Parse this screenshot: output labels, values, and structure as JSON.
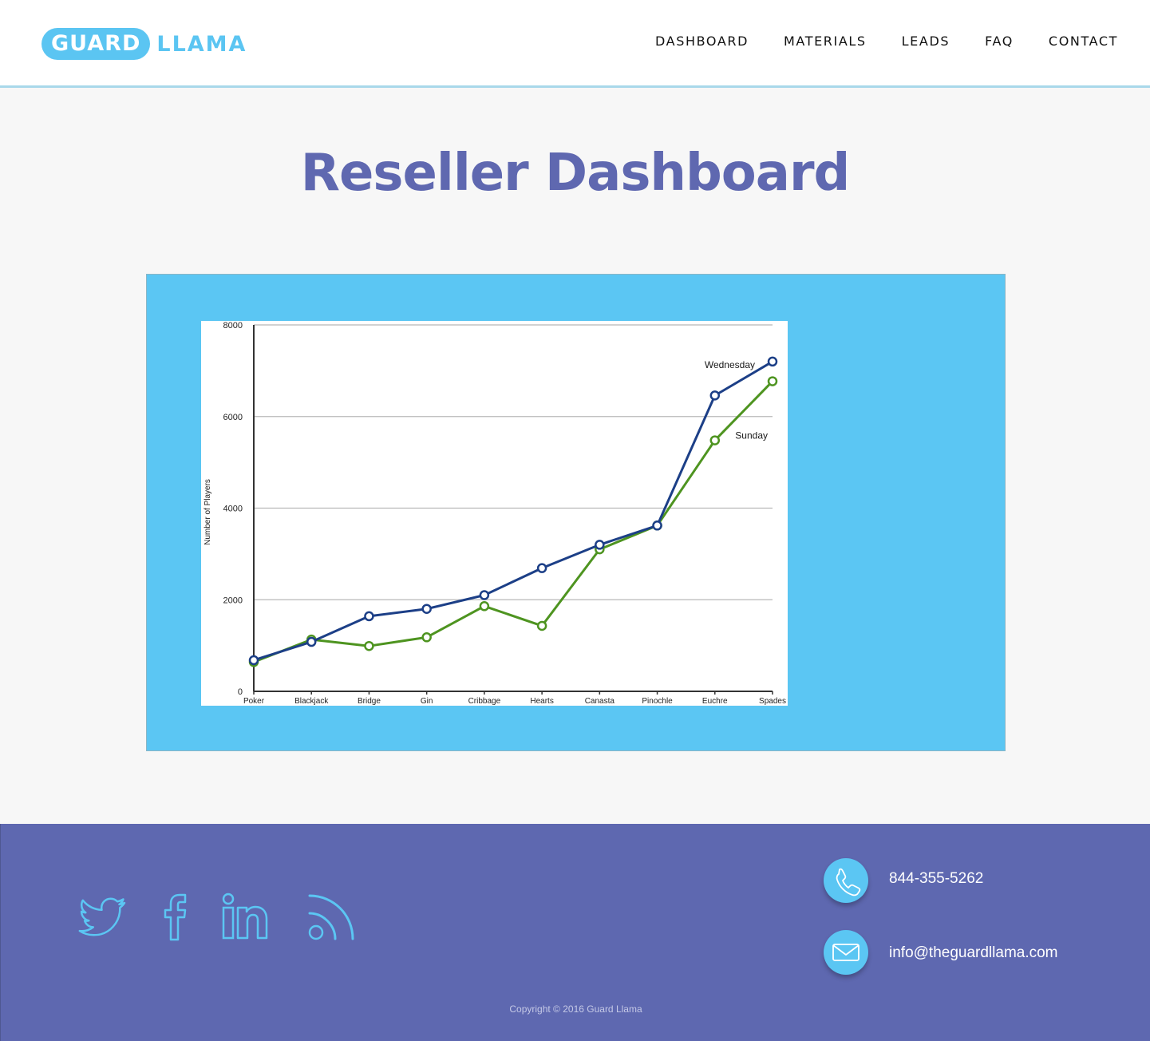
{
  "header": {
    "logo": {
      "part1": "GUARD",
      "part2": "LLAMA"
    },
    "nav": [
      {
        "label": "DASHBOARD"
      },
      {
        "label": "MATERIALS"
      },
      {
        "label": "LEADS"
      },
      {
        "label": "FAQ"
      },
      {
        "label": "CONTACT"
      }
    ]
  },
  "main": {
    "title": "Reseller Dashboard"
  },
  "chart_data": {
    "type": "line",
    "categories": [
      "Poker",
      "Blackjack",
      "Bridge",
      "Gin",
      "Cribbage",
      "Hearts",
      "Canasta",
      "Pinochle",
      "Euchre",
      "Spades"
    ],
    "series": [
      {
        "name": "Wednesday",
        "color": "#1c3f87",
        "values": [
          680,
          1080,
          1640,
          1800,
          2100,
          2690,
          3200,
          3620,
          6460,
          7200
        ]
      },
      {
        "name": "Sunday",
        "color": "#4e9420",
        "values": [
          640,
          1130,
          990,
          1180,
          1860,
          1430,
          3100,
          3620,
          5480,
          6770
        ]
      }
    ],
    "ylabel": "Number of Players",
    "xlabel": "",
    "ylim": [
      0,
      8000
    ],
    "yticks": [
      "0",
      "2000",
      "4000",
      "6000",
      "8000"
    ],
    "grid": true,
    "legend": "inline labels near line ends"
  },
  "footer": {
    "social": [
      {
        "icon": "twitter-icon"
      },
      {
        "icon": "facebook-icon"
      },
      {
        "icon": "linkedin-icon"
      },
      {
        "icon": "rss-icon"
      }
    ],
    "phone": "844-355-5262",
    "email": "info@theguardllama.com",
    "copyright": "Copyright © 2016 Guard Llama",
    "accent_color": "#5bc6f3",
    "background_color": "#5e68b0"
  }
}
